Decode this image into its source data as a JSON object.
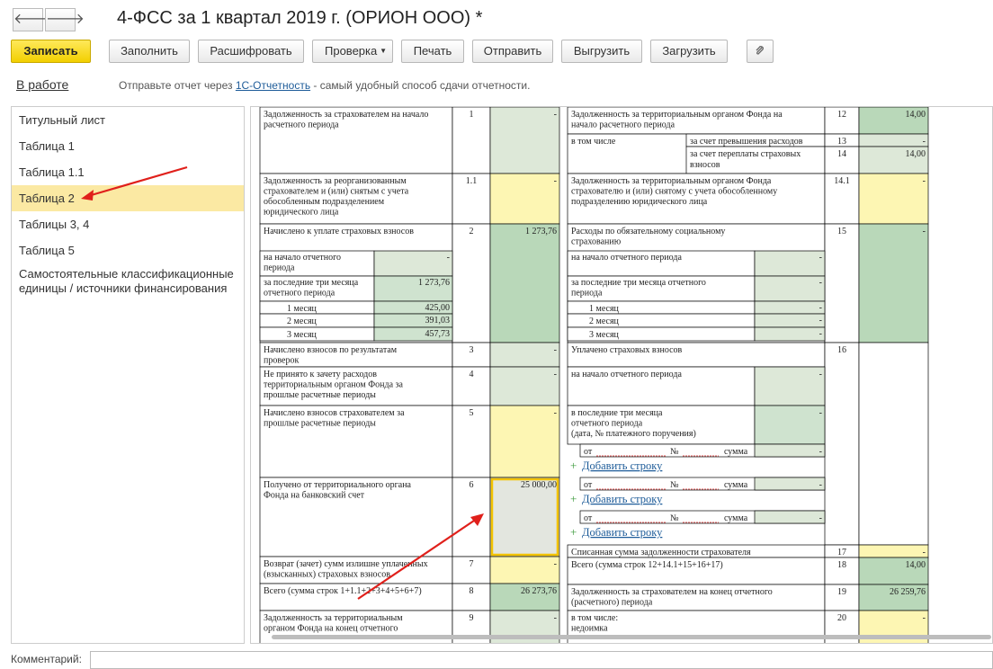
{
  "window": {
    "title": "4-ФСС за 1 квартал 2019 г. (ОРИОН ООО) *"
  },
  "nav": {
    "back": "🡐",
    "forward": "🡒"
  },
  "toolbar": {
    "save": "Записать",
    "fill": "Заполнить",
    "decode": "Расшифровать",
    "check": "Проверка",
    "print": "Печать",
    "send": "Отправить",
    "export": "Выгрузить",
    "import": "Загрузить"
  },
  "status": {
    "state": "В работе",
    "prefix": "Отправьте отчет через ",
    "link": "1С-Отчетность",
    "suffix": " - самый удобный способ сдачи отчетности."
  },
  "sidebar": {
    "items": [
      {
        "label": "Титульный лист"
      },
      {
        "label": "Таблица 1"
      },
      {
        "label": "Таблица 1.1"
      },
      {
        "label": "Таблица 2"
      },
      {
        "label": "Таблицы 3, 4"
      },
      {
        "label": "Таблица 5"
      },
      {
        "label": "Самостоятельные классификационные единицы / источники финансирования"
      }
    ]
  },
  "comment": {
    "label": "Комментарий:"
  },
  "left_table": [
    {
      "text": [
        "Задолженность за страхователем на начало",
        "расчетного периода"
      ],
      "code": "1",
      "value": "-",
      "color": "#dde8d8"
    },
    {
      "text": [
        "Задолженность за реорганизованным",
        "страхователем и (или) снятым с учета",
        "обособленным подразделением",
        "юридического лица"
      ],
      "code": "1.1",
      "value": "-",
      "color": "#fdf6b3"
    },
    {
      "text": [
        "Начислено к уплате страховых взносов"
      ],
      "code": "2",
      "value": "1 273,76",
      "color": "#b9d8b9",
      "sub": [
        {
          "label": [
            "на начало отчетного",
            "периода"
          ],
          "value": "-"
        },
        {
          "label": [
            "за последние три месяца",
            "отчетного периода"
          ],
          "value": "1 273,76"
        },
        {
          "label": [
            "1 месяц"
          ],
          "value": "425,00"
        },
        {
          "label": [
            "2 месяц"
          ],
          "value": "391,03"
        },
        {
          "label": [
            "3 месяц"
          ],
          "value": "457,73"
        }
      ]
    },
    {
      "text": [
        "Начислено взносов по результатам",
        "проверок"
      ],
      "code": "3",
      "value": "-",
      "color": "#dde8d8"
    },
    {
      "text": [
        "Не принято к зачету расходов",
        "территориальным органом Фонда за",
        "прошлые расчетные периоды"
      ],
      "code": "4",
      "value": "-",
      "color": "#dde8d8"
    },
    {
      "text": [
        "Начислено взносов страхователем за",
        "прошлые расчетные периоды"
      ],
      "code": "5",
      "value": "-",
      "color": "#fdf6b3"
    },
    {
      "text": [
        "Получено от территориального органа",
        "Фонда на банковский счет"
      ],
      "code": "6",
      "value": "25 000,00",
      "color": "#e3e6df"
    },
    {
      "text": [
        "Возврат (зачет) сумм излишне уплаченных",
        "(взысканных) страховых взносов"
      ],
      "code": "7",
      "value": "-",
      "color": "#fdf6b3"
    },
    {
      "text": [
        "Всего (сумма строк 1+1.1+2+3+4+5+6+7)"
      ],
      "code": "8",
      "value": "26 273,76",
      "color": "#b9d8b9"
    },
    {
      "text": [
        "Задолженность за территориальным",
        "органом Фонда на конец отчетного"
      ],
      "code": "9",
      "value": "-",
      "color": "#dde8d8"
    }
  ],
  "right_table": [
    {
      "text": [
        "Задолженность за территориальным органом Фонда на",
        "начало расчетного периода"
      ],
      "code": "12",
      "value": "14,00"
    },
    {
      "text": [
        "в том числе"
      ],
      "sub1": "за счет превышения расходов",
      "code": "13",
      "value": "-"
    },
    {
      "sub1": "за счет переплаты страховых",
      "sub2": "взносов",
      "code": "14",
      "value": "14,00"
    },
    {
      "text": [
        "Задолженность за территориальным органом Фонда",
        "страхователю и (или) снятому с учета обособленному",
        "подразделению юридического лица"
      ],
      "code": "14.1",
      "value": "-"
    },
    {
      "text": [
        "Расходы по обязательному социальному",
        "страхованию"
      ],
      "code": "15",
      "value": "-",
      "sub": [
        {
          "label": [
            "на начало отчетного периода"
          ],
          "value": "-"
        },
        {
          "label": [
            "за последние три месяца отчетного",
            "периода"
          ],
          "value": "-"
        },
        {
          "label": [
            "1 месяц"
          ],
          "value": "-"
        },
        {
          "label": [
            "2 месяц"
          ],
          "value": "-"
        },
        {
          "label": [
            "3 месяц"
          ],
          "value": "-"
        }
      ]
    },
    {
      "text": [
        "Уплачено страховых взносов"
      ],
      "code": "16"
    },
    {
      "text": [
        "на начало отчетного периода"
      ],
      "value": "-"
    },
    {
      "text": [
        "в последние три месяца",
        "отчетного периода",
        "(дата, № платежного поручения)"
      ],
      "value": "-"
    },
    {
      "pay_from": "от",
      "pay_no": "№",
      "pay_sum": "сумма",
      "value": "-"
    },
    {
      "add_row": "Добавить строку"
    },
    {
      "text": [
        "Списанная сумма задолженности страхователя"
      ],
      "code": "17",
      "value": "-"
    },
    {
      "text": [
        "Всего (сумма строк 12+14.1+15+16+17)"
      ],
      "code": "18",
      "value": "14,00"
    },
    {
      "text": [
        "Задолженность за страхователем на конец отчетного",
        "(расчетного) периода"
      ],
      "code": "19",
      "value": "26 259,76"
    },
    {
      "text": [
        "в том числе:",
        "недоимка"
      ],
      "code": "20",
      "value": "-"
    }
  ]
}
